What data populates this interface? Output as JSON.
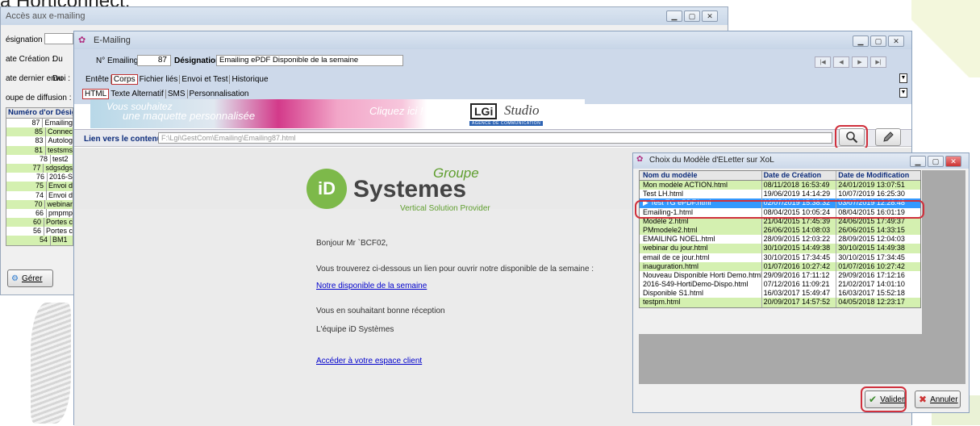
{
  "caption_partial": "à Horticonnect.",
  "bg_window": {
    "title": "Accès aux e-mailing",
    "labels": [
      "ésignation :",
      "ate Création :",
      "ate dernier envoi :",
      "oupe de diffusion :"
    ],
    "du1": "Du",
    "du2": "Du",
    "grid_header": "Numéro d'or  Désign",
    "rows": [
      {
        "n": "87",
        "t": "Emailing"
      },
      {
        "n": "85",
        "t": "Connec"
      },
      {
        "n": "83",
        "t": "Autolog"
      },
      {
        "n": "81",
        "t": "testsms"
      },
      {
        "n": "78",
        "t": "test2"
      },
      {
        "n": "77",
        "t": "sdgsdgs"
      },
      {
        "n": "76",
        "t": "2016-S"
      },
      {
        "n": "75",
        "t": "Envoi d"
      },
      {
        "n": "74",
        "t": "Envoi d"
      },
      {
        "n": "70",
        "t": "webinar"
      },
      {
        "n": "66",
        "t": "pmpmp"
      },
      {
        "n": "60",
        "t": "Portes c"
      },
      {
        "n": "56",
        "t": "Portes c"
      },
      {
        "n": "54",
        "t": "BM1"
      }
    ],
    "gerer_label": "Gérer"
  },
  "emailing_window": {
    "title": "E-Mailing",
    "num_label": "N° Emailing",
    "num_value": "87",
    "designation_label": "Désignation",
    "designation_value": "Emailing ePDF Disponible de la semaine",
    "tabs1": [
      "Entête",
      "Corps",
      "Fichier liés",
      "Envoi et Test",
      "Historique"
    ],
    "tabs2": [
      "HTML",
      "Texte Alternatif",
      "SMS",
      "Personnalisation"
    ],
    "banner": {
      "t1": "Vous souhaitez",
      "t2": "une maquette personnalisée",
      "t3": "Cliquez ici !",
      "lgi": "LGi",
      "studio": "Studio",
      "sub": "AGENCE DE COMMUNICATION"
    },
    "link_label": "Lien vers le contenu",
    "link_value": "F:\\Lgi\\GestCom\\Emailing\\Emailing87.html",
    "logo": {
      "groupe": "Groupe",
      "id": "iD",
      "systemes": "Systemes",
      "tagline": "Vertical Solution Provider"
    },
    "body": {
      "greeting": "Bonjour Mr `BCF02,",
      "intro": "Vous trouverez ci-dessous un lien pour ouvrir notre disponible de la semaine :",
      "link1": "Notre disponible de la semaine",
      "closing": "Vous en souhaitant bonne réception",
      "signature": "L'équipe iD Systèmes",
      "link2": "Accéder à votre espace client"
    }
  },
  "dialog": {
    "title": "Choix du Modèle d'ELetter sur XoL",
    "col_name": "Nom du modèle",
    "col_created": "Date de Création",
    "col_modified": "Date de Modification",
    "rows": [
      {
        "name": "Mon modèle ACTION.html",
        "c": "08/11/2018 16:53:49",
        "m": "24/01/2019 13:07:51",
        "s": "g"
      },
      {
        "name": "Test LH.html",
        "c": "19/06/2019 14:14:29",
        "m": "10/07/2019 16:25:30",
        "s": "w"
      },
      {
        "name": "Test TG ePDF.html",
        "c": "02/07/2019 15:38:32",
        "m": "03/07/2019 12:28:48",
        "s": "s"
      },
      {
        "name": "Emailing-1.html",
        "c": "08/04/2015 10:05:24",
        "m": "08/04/2015 16:01:19",
        "s": "w"
      },
      {
        "name": "Modèle 2.html",
        "c": "21/04/2015 17:45:39",
        "m": "24/06/2015 17:49:37",
        "s": "g"
      },
      {
        "name": "PMmodele2.html",
        "c": "26/06/2015 14:08:03",
        "m": "26/06/2015 14:33:15",
        "s": "g"
      },
      {
        "name": "EMAILING NOEL.html",
        "c": "28/09/2015 12:03:22",
        "m": "28/09/2015 12:04:03",
        "s": "w"
      },
      {
        "name": "webinar du jour.html",
        "c": "30/10/2015 14:49:38",
        "m": "30/10/2015 14:49:38",
        "s": "g"
      },
      {
        "name": "email de ce jour.html",
        "c": "30/10/2015 17:34:45",
        "m": "30/10/2015 17:34:45",
        "s": "w"
      },
      {
        "name": "inauguration.html",
        "c": "01/07/2016 10:27:42",
        "m": "01/07/2016 10:27:42",
        "s": "g"
      },
      {
        "name": "Nouveau Disponible Horti Demo.html",
        "c": "29/09/2016 17:11:12",
        "m": "29/09/2016 17:12:16",
        "s": "w"
      },
      {
        "name": "2016-S49-HortiDemo-Dispo.html",
        "c": "07/12/2016 11:09:21",
        "m": "21/02/2017 14:01:10",
        "s": "w"
      },
      {
        "name": "Disponible S1.html",
        "c": "16/03/2017 15:49:47",
        "m": "16/03/2017 15:52:18",
        "s": "w"
      },
      {
        "name": "testpm.html",
        "c": "20/09/2017 14:57:52",
        "m": "04/05/2018 12:23:17",
        "s": "g"
      }
    ],
    "valider": "Valider",
    "annuler": "Annuler"
  },
  "colors": {
    "accent_red": "#d0303c",
    "row_green": "#d4f0b0",
    "selection": "#3399ff",
    "header_blue": "#cdd9ea"
  }
}
